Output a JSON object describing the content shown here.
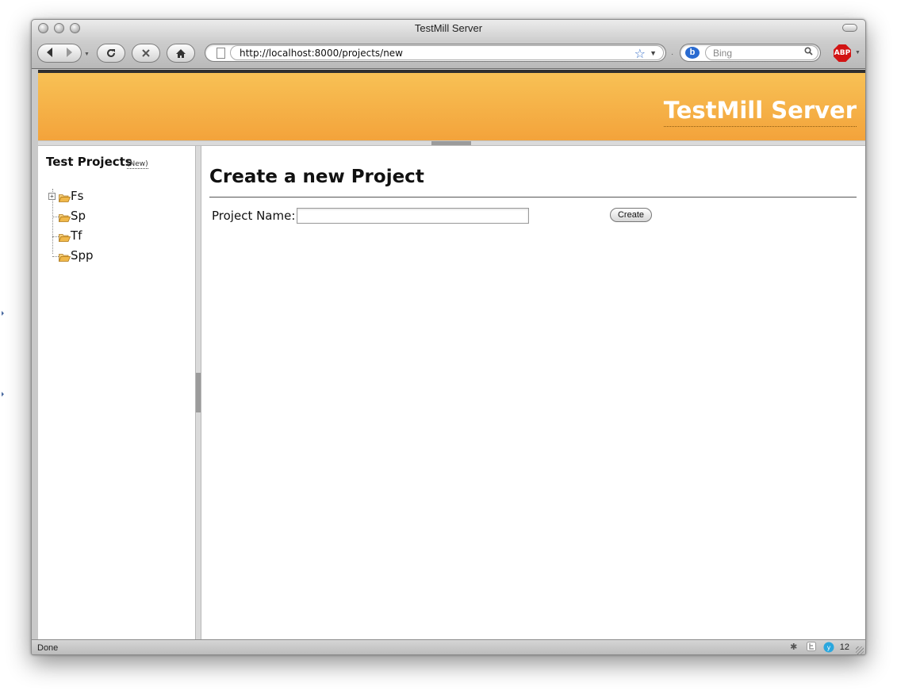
{
  "window": {
    "title": "TestMill Server"
  },
  "toolbar": {
    "url": "http://localhost:8000/projects/new",
    "search_placeholder": "Bing",
    "search_engine_logo": "b",
    "adblock_label": "ABP"
  },
  "banner": {
    "title": "TestMill Server"
  },
  "sidebar": {
    "heading": "Test Projects",
    "new_link": "(New)",
    "projects": [
      {
        "label": "Fs",
        "expandable": true
      },
      {
        "label": "Sp",
        "expandable": false
      },
      {
        "label": "Tf",
        "expandable": false
      },
      {
        "label": "Spp",
        "expandable": false
      }
    ]
  },
  "main": {
    "heading": "Create a new Project",
    "form": {
      "name_label": "Project Name:",
      "name_value": "",
      "submit_label": "Create"
    }
  },
  "status": {
    "text": "Done",
    "badge_count": "12"
  },
  "colors": {
    "banner_top": "#f8c155",
    "banner_bottom": "#f3a33b",
    "folder": "#f0b84a"
  }
}
